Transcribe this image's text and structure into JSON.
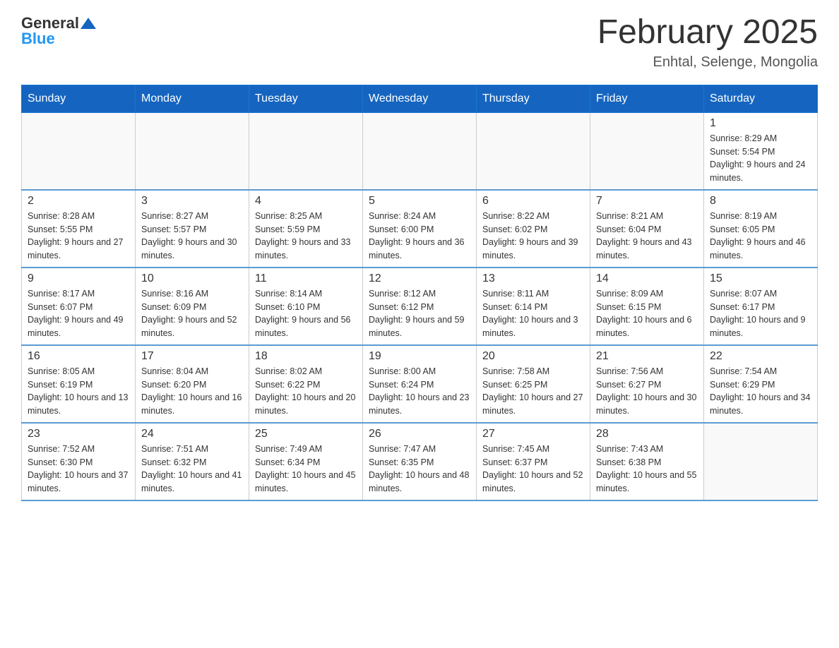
{
  "header": {
    "logo_general": "General",
    "logo_blue": "Blue",
    "month_title": "February 2025",
    "location": "Enhtal, Selenge, Mongolia"
  },
  "weekdays": [
    "Sunday",
    "Monday",
    "Tuesday",
    "Wednesday",
    "Thursday",
    "Friday",
    "Saturday"
  ],
  "weeks": [
    {
      "days": [
        {
          "number": "",
          "info": "",
          "empty": true
        },
        {
          "number": "",
          "info": "",
          "empty": true
        },
        {
          "number": "",
          "info": "",
          "empty": true
        },
        {
          "number": "",
          "info": "",
          "empty": true
        },
        {
          "number": "",
          "info": "",
          "empty": true
        },
        {
          "number": "",
          "info": "",
          "empty": true
        },
        {
          "number": "1",
          "info": "Sunrise: 8:29 AM\nSunset: 5:54 PM\nDaylight: 9 hours and 24 minutes."
        }
      ]
    },
    {
      "days": [
        {
          "number": "2",
          "info": "Sunrise: 8:28 AM\nSunset: 5:55 PM\nDaylight: 9 hours and 27 minutes."
        },
        {
          "number": "3",
          "info": "Sunrise: 8:27 AM\nSunset: 5:57 PM\nDaylight: 9 hours and 30 minutes."
        },
        {
          "number": "4",
          "info": "Sunrise: 8:25 AM\nSunset: 5:59 PM\nDaylight: 9 hours and 33 minutes."
        },
        {
          "number": "5",
          "info": "Sunrise: 8:24 AM\nSunset: 6:00 PM\nDaylight: 9 hours and 36 minutes."
        },
        {
          "number": "6",
          "info": "Sunrise: 8:22 AM\nSunset: 6:02 PM\nDaylight: 9 hours and 39 minutes."
        },
        {
          "number": "7",
          "info": "Sunrise: 8:21 AM\nSunset: 6:04 PM\nDaylight: 9 hours and 43 minutes."
        },
        {
          "number": "8",
          "info": "Sunrise: 8:19 AM\nSunset: 6:05 PM\nDaylight: 9 hours and 46 minutes."
        }
      ]
    },
    {
      "days": [
        {
          "number": "9",
          "info": "Sunrise: 8:17 AM\nSunset: 6:07 PM\nDaylight: 9 hours and 49 minutes."
        },
        {
          "number": "10",
          "info": "Sunrise: 8:16 AM\nSunset: 6:09 PM\nDaylight: 9 hours and 52 minutes."
        },
        {
          "number": "11",
          "info": "Sunrise: 8:14 AM\nSunset: 6:10 PM\nDaylight: 9 hours and 56 minutes."
        },
        {
          "number": "12",
          "info": "Sunrise: 8:12 AM\nSunset: 6:12 PM\nDaylight: 9 hours and 59 minutes."
        },
        {
          "number": "13",
          "info": "Sunrise: 8:11 AM\nSunset: 6:14 PM\nDaylight: 10 hours and 3 minutes."
        },
        {
          "number": "14",
          "info": "Sunrise: 8:09 AM\nSunset: 6:15 PM\nDaylight: 10 hours and 6 minutes."
        },
        {
          "number": "15",
          "info": "Sunrise: 8:07 AM\nSunset: 6:17 PM\nDaylight: 10 hours and 9 minutes."
        }
      ]
    },
    {
      "days": [
        {
          "number": "16",
          "info": "Sunrise: 8:05 AM\nSunset: 6:19 PM\nDaylight: 10 hours and 13 minutes."
        },
        {
          "number": "17",
          "info": "Sunrise: 8:04 AM\nSunset: 6:20 PM\nDaylight: 10 hours and 16 minutes."
        },
        {
          "number": "18",
          "info": "Sunrise: 8:02 AM\nSunset: 6:22 PM\nDaylight: 10 hours and 20 minutes."
        },
        {
          "number": "19",
          "info": "Sunrise: 8:00 AM\nSunset: 6:24 PM\nDaylight: 10 hours and 23 minutes."
        },
        {
          "number": "20",
          "info": "Sunrise: 7:58 AM\nSunset: 6:25 PM\nDaylight: 10 hours and 27 minutes."
        },
        {
          "number": "21",
          "info": "Sunrise: 7:56 AM\nSunset: 6:27 PM\nDaylight: 10 hours and 30 minutes."
        },
        {
          "number": "22",
          "info": "Sunrise: 7:54 AM\nSunset: 6:29 PM\nDaylight: 10 hours and 34 minutes."
        }
      ]
    },
    {
      "days": [
        {
          "number": "23",
          "info": "Sunrise: 7:52 AM\nSunset: 6:30 PM\nDaylight: 10 hours and 37 minutes."
        },
        {
          "number": "24",
          "info": "Sunrise: 7:51 AM\nSunset: 6:32 PM\nDaylight: 10 hours and 41 minutes."
        },
        {
          "number": "25",
          "info": "Sunrise: 7:49 AM\nSunset: 6:34 PM\nDaylight: 10 hours and 45 minutes."
        },
        {
          "number": "26",
          "info": "Sunrise: 7:47 AM\nSunset: 6:35 PM\nDaylight: 10 hours and 48 minutes."
        },
        {
          "number": "27",
          "info": "Sunrise: 7:45 AM\nSunset: 6:37 PM\nDaylight: 10 hours and 52 minutes."
        },
        {
          "number": "28",
          "info": "Sunrise: 7:43 AM\nSunset: 6:38 PM\nDaylight: 10 hours and 55 minutes."
        },
        {
          "number": "",
          "info": "",
          "empty": true
        }
      ]
    }
  ]
}
